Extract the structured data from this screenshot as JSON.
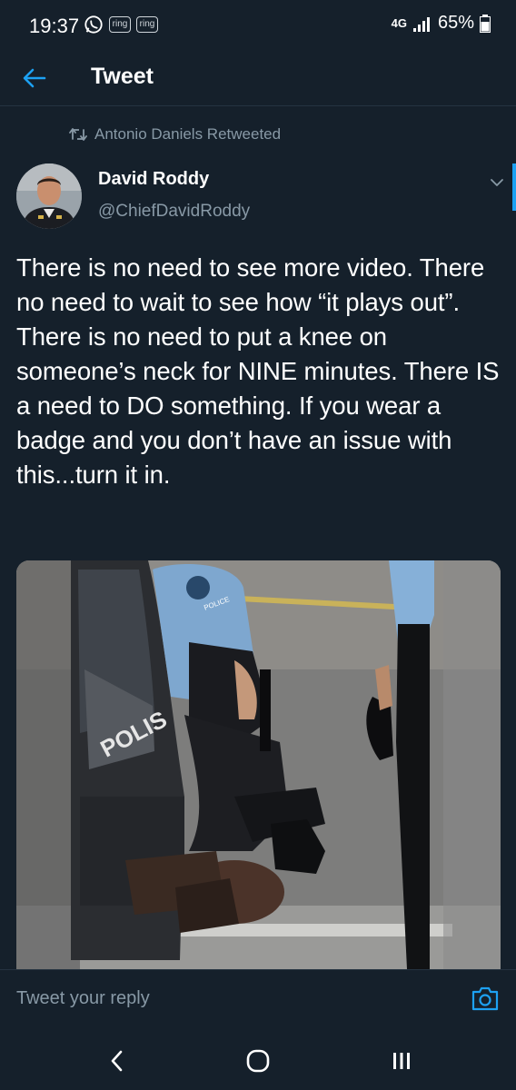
{
  "status_bar": {
    "time": "19:37",
    "ring_label_1": "ring",
    "ring_label_2": "ring",
    "network": "4G",
    "battery": "65%"
  },
  "header": {
    "title": "Tweet"
  },
  "tweet": {
    "retweeted_by": "Antonio Daniels Retweeted",
    "author_name": "David Roddy",
    "author_handle": "@ChiefDavidRoddy",
    "text": "There is no need to see more video. There no need to wait to see how “it plays out”. There is no need to put a knee on someone’s neck for NINE minutes. There IS a need to DO something. If you wear a badge and you don’t have an issue with this...turn it in.",
    "image_overlay_text": "POLIS",
    "image_badge_text": "POLICE"
  },
  "reply": {
    "placeholder": "Tweet your reply"
  },
  "colors": {
    "background": "#15202b",
    "accent": "#1da1f2",
    "secondary_text": "#8899a6"
  }
}
